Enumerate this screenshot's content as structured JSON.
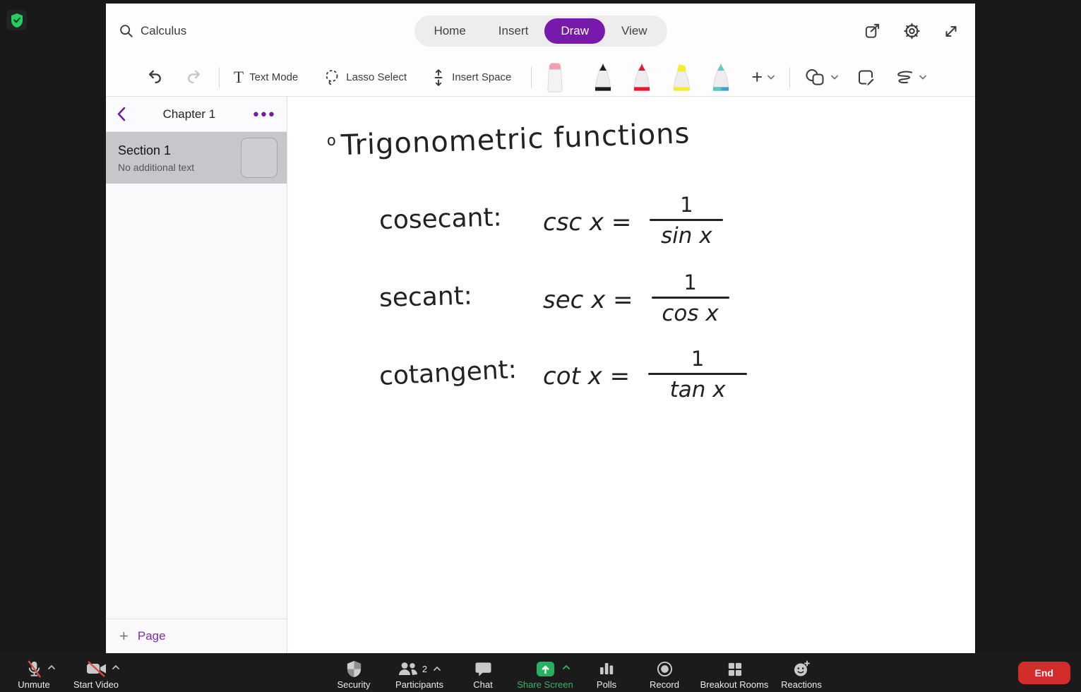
{
  "colors": {
    "accent_purple": "#7719aa",
    "share_green": "#27b15e",
    "end_red": "#d42b2b",
    "slash_red": "#e0493e",
    "ink": "#222222"
  },
  "app": {
    "search_value": "Calculus",
    "tabs": [
      "Home",
      "Insert",
      "Draw",
      "View"
    ],
    "selected_tab": "Draw",
    "draw_toolbar": {
      "text_mode": "Text Mode",
      "lasso_select": "Lasso Select",
      "insert_space": "Insert Space",
      "pen_colors": [
        "#1c1c1c",
        "#e8192c",
        "#f4ed2f",
        "#5ecfbe"
      ]
    },
    "sidebar": {
      "header_title": "Chapter 1",
      "section_title": "Section 1",
      "section_subtitle": "No additional text",
      "add_page": "Page"
    },
    "notes": {
      "bullet": "o",
      "title": "Trigonometric functions",
      "entries": [
        {
          "term": "cosecant:",
          "expr": "csc x =",
          "numerator": "1",
          "denominator": "sin x"
        },
        {
          "term": "secant:",
          "expr": "sec x =",
          "numerator": "1",
          "denominator": "cos x"
        },
        {
          "term": "cotangent:",
          "expr": "cot x =",
          "numerator": "1",
          "denominator": "tan x"
        }
      ]
    }
  },
  "zoom_bar": {
    "unmute": "Unmute",
    "start_video": "Start Video",
    "security": "Security",
    "participants": "Participants",
    "participants_count": "2",
    "chat": "Chat",
    "share_screen": "Share Screen",
    "polls": "Polls",
    "record": "Record",
    "breakout_rooms": "Breakout Rooms",
    "reactions": "Reactions",
    "end": "End"
  },
  "icons": {
    "encryption": "green-shield-check",
    "search": "magnifier",
    "share": "box-arrow-out",
    "settings": "gear",
    "fullscreen": "diagonal-arrows",
    "undo": "curved-arrow-left",
    "redo": "curved-arrow-right",
    "lasso": "dashed-circle",
    "insert_space": "vertical-arrows",
    "eraser": "pink-cap-eraser",
    "shapes": "circle-square",
    "note_pen": "page-with-pen",
    "ink_shape": "squiggle",
    "mic_muted": "mic-red-slash",
    "video_muted": "camera-red-slash",
    "security": "shield",
    "participants": "two-people",
    "chat": "speech-bubble",
    "share_screen": "green-up-arrow-box",
    "polls": "bar-chart",
    "record": "circle-dot",
    "breakout": "grid-2x2",
    "reactions": "smiley-plus"
  }
}
